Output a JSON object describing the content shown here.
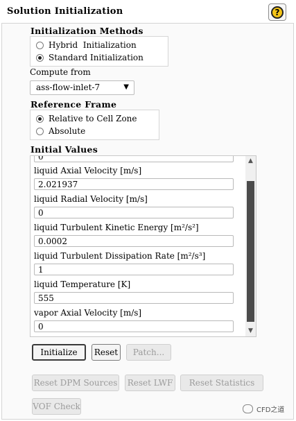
{
  "header": {
    "title": "Solution Initialization",
    "help_glyph": "?"
  },
  "init_methods": {
    "label": "Initialization Methods",
    "options": [
      {
        "label": "Hybrid  Initialization",
        "selected": false
      },
      {
        "label": "Standard Initialization",
        "selected": true
      }
    ]
  },
  "compute_from": {
    "label": "Compute from",
    "selected": "ass-flow-inlet-7"
  },
  "reference_frame": {
    "label": "Reference Frame",
    "options": [
      {
        "label": "Relative to Cell Zone",
        "selected": true
      },
      {
        "label": "Absolute",
        "selected": false
      }
    ]
  },
  "initial_values": {
    "label": "Initial Values",
    "top_partial_value": "0",
    "fields": [
      {
        "label": "liquid Axial Velocity [m/s]",
        "value": "2.021937"
      },
      {
        "label": "liquid Radial Velocity [m/s]",
        "value": "0"
      },
      {
        "label": "liquid Turbulent Kinetic Energy [m²/s²]",
        "value": "0.0002"
      },
      {
        "label": "liquid Turbulent Dissipation Rate [m²/s³]",
        "value": "1"
      },
      {
        "label": "liquid Temperature [K]",
        "value": "555"
      },
      {
        "label": "vapor Axial Velocity [m/s]",
        "value": "0"
      }
    ]
  },
  "buttons": {
    "initialize": "Initialize",
    "reset": "Reset",
    "patch": "Patch...",
    "reset_dpm": "Reset DPM Sources",
    "reset_lwf": "Reset LWF",
    "reset_stats": "Reset Statistics",
    "vof_check": "VOF Check"
  },
  "watermark": {
    "text": "CFD之道"
  }
}
